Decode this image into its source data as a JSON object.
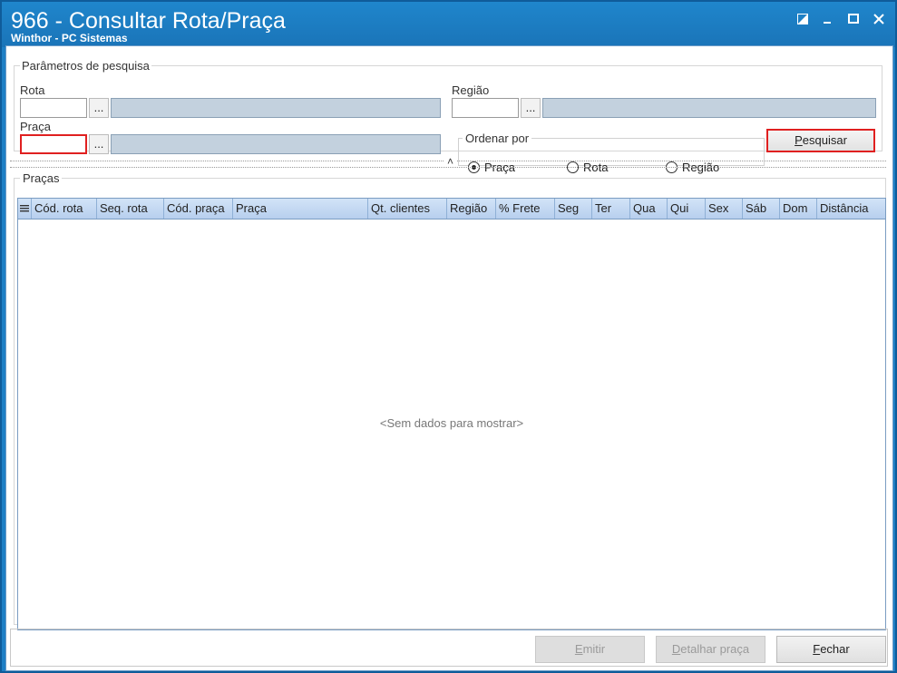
{
  "window": {
    "title": "966 - Consultar Rota/Praça",
    "subtitle": "Winthor - PC Sistemas"
  },
  "params": {
    "legend": "Parâmetros de pesquisa",
    "rota_label": "Rota",
    "regiao_label": "Região",
    "praca_label": "Praça",
    "lookup_label": "...",
    "rota_value": "",
    "regiao_value": "",
    "praca_value": ""
  },
  "order": {
    "legend": "Ordenar por",
    "options": [
      {
        "label": "Praça",
        "selected": true
      },
      {
        "label": "Rota",
        "selected": false
      },
      {
        "label": "Região",
        "selected": false
      }
    ]
  },
  "search_button": {
    "first": "P",
    "rest": "esquisar"
  },
  "pracas": {
    "legend": "Praças",
    "columns": [
      "Cód. rota",
      "Seq. rota",
      "Cód. praça",
      "Praça",
      "Qt. clientes",
      "Região",
      "% Frete",
      "Seg",
      "Ter",
      "Qua",
      "Qui",
      "Sex",
      "Sáb",
      "Dom",
      "Distância"
    ],
    "empty_text": "<Sem dados para mostrar>"
  },
  "footer": {
    "emitir": {
      "first": "E",
      "rest": "mitir"
    },
    "detalhar": {
      "first": "D",
      "rest": "etalhar praça"
    },
    "fechar": {
      "first": "F",
      "rest": "echar"
    }
  },
  "colors": {
    "title_bar": "#1a74b8",
    "grid_header": "#b7cfee",
    "highlight": "#e02020"
  }
}
